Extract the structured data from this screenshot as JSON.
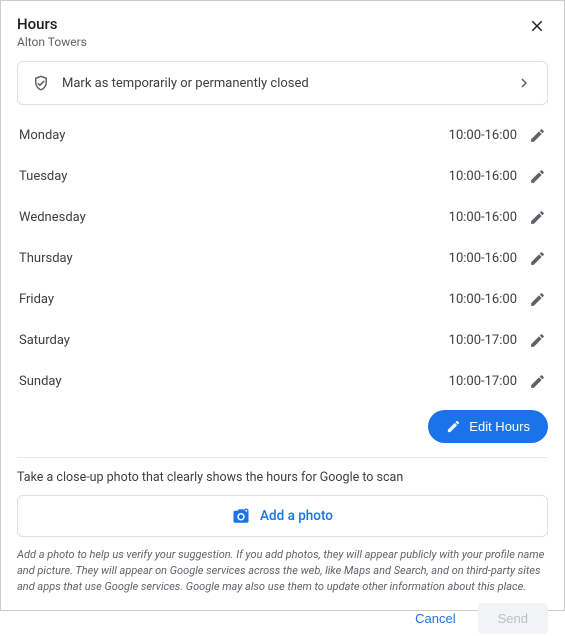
{
  "header": {
    "title": "Hours",
    "subtitle": "Alton Towers"
  },
  "closed_row": {
    "label": "Mark as temporarily or permanently closed"
  },
  "days": [
    {
      "name": "Monday",
      "hours": "10:00-16:00"
    },
    {
      "name": "Tuesday",
      "hours": "10:00-16:00"
    },
    {
      "name": "Wednesday",
      "hours": "10:00-16:00"
    },
    {
      "name": "Thursday",
      "hours": "10:00-16:00"
    },
    {
      "name": "Friday",
      "hours": "10:00-16:00"
    },
    {
      "name": "Saturday",
      "hours": "10:00-17:00"
    },
    {
      "name": "Sunday",
      "hours": "10:00-17:00"
    }
  ],
  "edit_hours_label": "Edit Hours",
  "photo_hint": "Take a close-up photo that clearly shows the hours for Google to scan",
  "add_photo_label": "Add a photo",
  "disclaimer": "Add a photo to help us verify your suggestion. If you add photos, they will appear publicly with your profile name and picture. They will appear on Google services across the web, like Maps and Search, and on third-party sites and apps that use Google services. Google may also use them to update other information about this place.",
  "footer": {
    "cancel": "Cancel",
    "send": "Send"
  }
}
